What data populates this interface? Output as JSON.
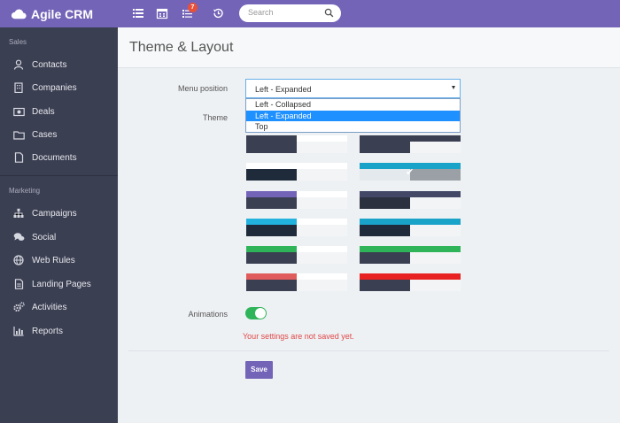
{
  "app": {
    "brand": "Agile CRM",
    "accent": "#7464b8"
  },
  "topbar": {
    "icons": [
      "list-icon",
      "calendar-icon",
      "tasks-icon",
      "history-icon"
    ],
    "tasks_badge": "7",
    "search_placeholder": "Search"
  },
  "sidebar": {
    "sections": [
      {
        "label": "Sales",
        "items": [
          {
            "label": "Contacts",
            "icon": "user-icon"
          },
          {
            "label": "Companies",
            "icon": "building-icon"
          },
          {
            "label": "Deals",
            "icon": "money-icon"
          },
          {
            "label": "Cases",
            "icon": "folder-icon"
          },
          {
            "label": "Documents",
            "icon": "document-icon"
          }
        ]
      },
      {
        "label": "Marketing",
        "items": [
          {
            "label": "Campaigns",
            "icon": "sitemap-icon"
          },
          {
            "label": "Social",
            "icon": "chat-icon"
          },
          {
            "label": "Web Rules",
            "icon": "globe-icon"
          },
          {
            "label": "Landing Pages",
            "icon": "page-icon"
          },
          {
            "label": "Activities",
            "icon": "gears-icon"
          },
          {
            "label": "Reports",
            "icon": "bar-chart-icon"
          }
        ]
      }
    ]
  },
  "page": {
    "title": "Theme & Layout",
    "menu_position": {
      "label": "Menu position",
      "value": "Left - Expanded",
      "options": [
        "Left - Collapsed",
        "Left - Expanded",
        "Top"
      ],
      "selected_index": 1
    },
    "theme": {
      "label": "Theme",
      "selected_index": 3,
      "swatches": [
        {
          "top": "#3b3f52",
          "side": "#3b3f52"
        },
        {
          "top": "#3b3f52",
          "side": "#3b3f52"
        },
        {
          "top": "#ffffff",
          "side": "#1f2b3a"
        },
        {
          "top": "#1aa3c9",
          "side": "#e3e9ed"
        },
        {
          "top": "#7464b8",
          "side": "#3b3f52"
        },
        {
          "top": "#434867",
          "side": "#2c3140"
        },
        {
          "top": "#22b2de",
          "side": "#1f2b3a"
        },
        {
          "top": "#1aa3c9",
          "side": "#1f2b3a"
        },
        {
          "top": "#2fb45a",
          "side": "#3b3f52"
        },
        {
          "top": "#2fb45a",
          "side": "#3b3f52"
        },
        {
          "top": "#e05b5b",
          "side": "#3b3f52"
        },
        {
          "top": "#e82222",
          "side": "#3b3f52"
        }
      ]
    },
    "animations": {
      "label": "Animations",
      "on": true
    },
    "warning": "Your settings are not saved yet.",
    "save_label": "Save"
  }
}
